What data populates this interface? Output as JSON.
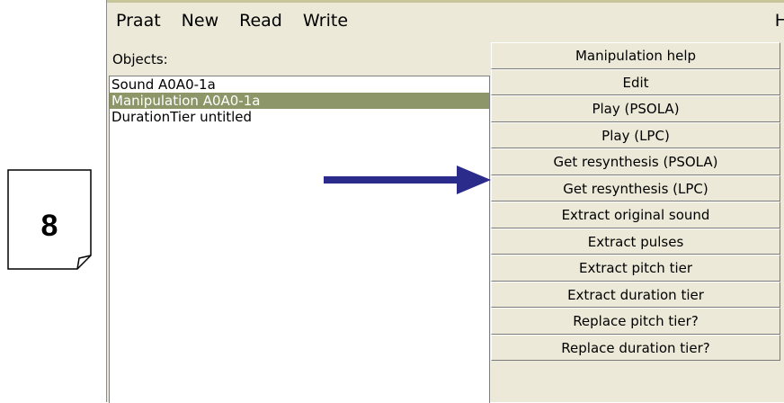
{
  "slide": {
    "page_number": "8"
  },
  "menubar": {
    "items": [
      "Praat",
      "New",
      "Read",
      "Write"
    ],
    "help_label": "H"
  },
  "objects": {
    "label": "Objects:",
    "items": [
      {
        "label": "Sound A0A0-1a",
        "selected": false
      },
      {
        "label": "Manipulation A0A0-1a",
        "selected": true
      },
      {
        "label": "DurationTier untitled",
        "selected": false
      }
    ]
  },
  "commands": [
    "Manipulation help",
    "Edit",
    "Play (PSOLA)",
    "Play (LPC)",
    "Get resynthesis (PSOLA)",
    "Get resynthesis (LPC)",
    "Extract original sound",
    "Extract pulses",
    "Extract pitch tier",
    "Extract duration tier",
    "Replace pitch tier?",
    "Replace duration tier?"
  ],
  "annotation": {
    "arrow_target": "Get resynthesis (PSOLA)",
    "arrow_color": "#2b2b8c"
  },
  "colors": {
    "selection": "#8c9668",
    "window_bg": "#ece9d8"
  }
}
